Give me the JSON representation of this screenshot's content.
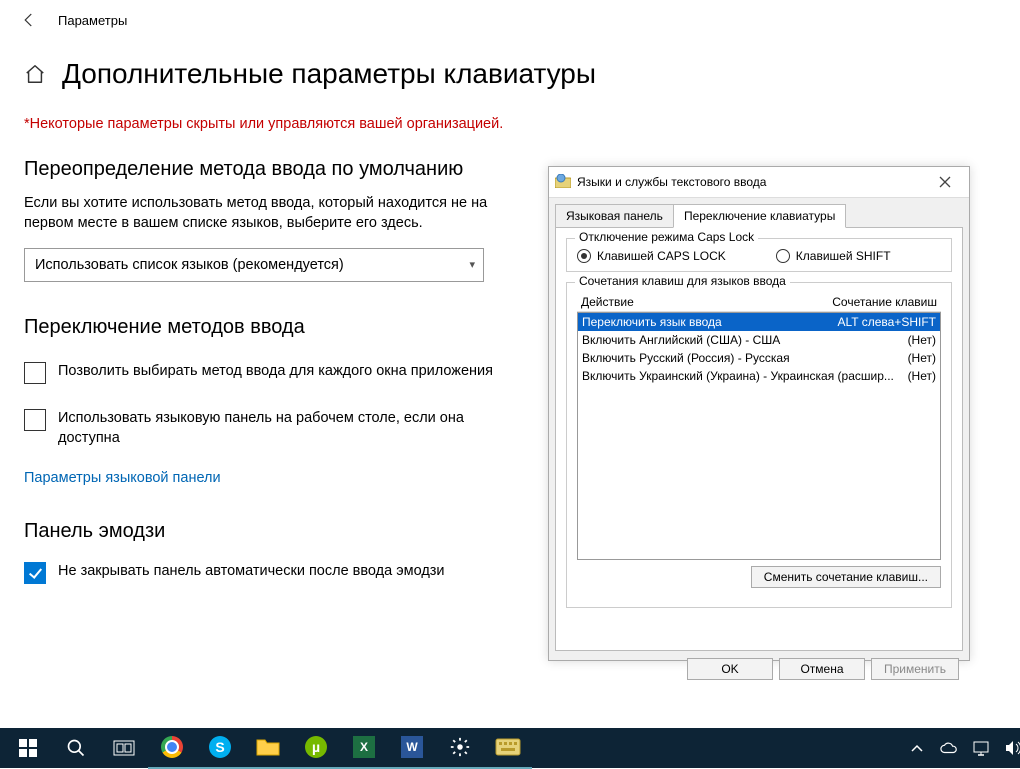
{
  "header": {
    "title": "Параметры"
  },
  "page": {
    "title": "Дополнительные параметры клавиатуры",
    "warning": "*Некоторые параметры скрыты или управляются вашей организацией."
  },
  "override": {
    "heading": "Переопределение метода ввода по умолчанию",
    "body": "Если вы хотите использовать метод ввода, который находится не на первом месте в вашем списке языков, выберите его здесь.",
    "dropdown_value": "Использовать список языков (рекомендуется)"
  },
  "switching": {
    "heading": "Переключение методов ввода",
    "chk_per_window": "Позволить выбирать метод ввода для каждого окна приложения",
    "chk_langbar": "Использовать языковую панель на рабочем столе, если она доступна",
    "link": "Параметры языковой панели"
  },
  "emoji": {
    "heading": "Панель эмодзи",
    "chk_label": "Не закрывать панель автоматически после ввода эмодзи"
  },
  "dialog": {
    "title": "Языки и службы текстового ввода",
    "tabs": {
      "t1": "Языковая панель",
      "t2": "Переключение клавиатуры"
    },
    "caps_group": "Отключение режима Caps Lock",
    "radio_caps": "Клавишей CAPS LOCK",
    "radio_shift": "Клавишей SHIFT",
    "hotkeys_group": "Сочетания клавиш для языков ввода",
    "col_action": "Действие",
    "col_keys": "Сочетание клавиш",
    "rows": [
      {
        "action": "Переключить язык ввода",
        "keys": "ALT слева+SHIFT"
      },
      {
        "action": "Включить Английский (США) - США",
        "keys": "(Нет)"
      },
      {
        "action": "Включить Русский (Россия) - Русская",
        "keys": "(Нет)"
      },
      {
        "action": "Включить Украинский (Украина) - Украинская (расшир...",
        "keys": "(Нет)"
      }
    ],
    "btn_change": "Сменить сочетание клавиш...",
    "btn_ok": "OK",
    "btn_cancel": "Отмена",
    "btn_apply": "Применить"
  }
}
